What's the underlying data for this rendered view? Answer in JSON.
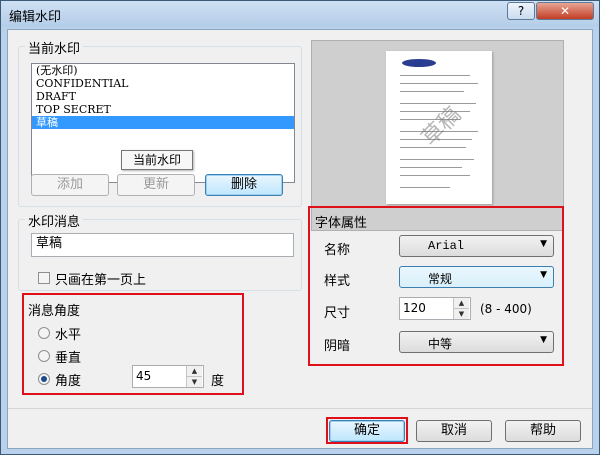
{
  "window": {
    "title": "编辑水印",
    "help_label": "?",
    "close_label": "✕"
  },
  "current_watermark": {
    "legend": "当前水印",
    "items": [
      "(无水印)",
      "CONFIDENTIAL",
      "DRAFT",
      "TOP SECRET",
      "草稿"
    ],
    "selected_index": 4,
    "tooltip": "当前水印",
    "add_label": "添加",
    "update_label": "更新",
    "delete_label": "删除"
  },
  "message": {
    "legend": "水印消息",
    "text_value": "草稿",
    "first_page_only_label": "只画在第一页上",
    "first_page_only_checked": false
  },
  "angle": {
    "legend": "消息角度",
    "horizontal_label": "水平",
    "vertical_label": "垂直",
    "angle_label": "角度",
    "selected": "angle",
    "angle_value": "45",
    "degree_unit": "度"
  },
  "preview": {
    "logo_text": "SAMSUNG",
    "watermark_text": "草稿"
  },
  "font": {
    "legend": "字体属性",
    "name_label": "名称",
    "name_value": "Arial",
    "style_label": "样式",
    "style_value": "常规",
    "size_label": "尺寸",
    "size_value": "120",
    "size_range": "(8 - 400)",
    "shade_label": "阴暗",
    "shade_value": "中等"
  },
  "footer": {
    "ok_label": "确定",
    "cancel_label": "取消",
    "help_label": "帮助"
  },
  "colors": {
    "highlight": "#e0101a",
    "selection": "#3399ff"
  }
}
